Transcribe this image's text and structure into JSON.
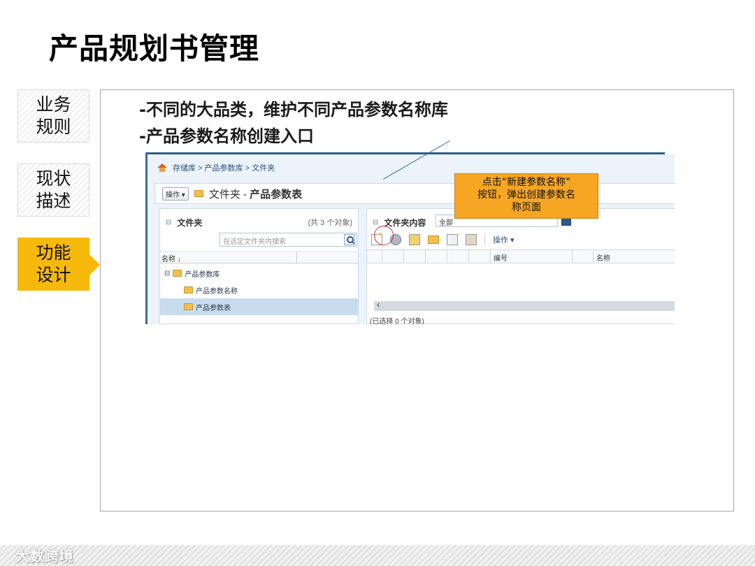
{
  "slide": {
    "title": "产品规划书管理",
    "tabs": [
      {
        "line1": "业务",
        "line2": "规则"
      },
      {
        "line1": "现状",
        "line2": "描述"
      },
      {
        "line1": "功能",
        "line2": "设计"
      }
    ],
    "bullets": [
      "-不同的大品类，维护不同产品参数名称库",
      "-产品参数名称创建入口"
    ],
    "callout": {
      "line1": "点击“新建参数名称”",
      "line2": "按钮，弹出创建参数名",
      "line3": "称页面"
    },
    "watermark": "大数跨境",
    "accent_color": "#f6b90c"
  },
  "screenshot": {
    "breadcrumb": "存储库 > 产品参数库 > 文件夹",
    "operate_button": "操作 ▾",
    "title_prefix": "文件夹 - ",
    "title_bold": "产品参数表",
    "left_pane": {
      "header": "文件夹",
      "count": "(共 3 个对象)",
      "search_placeholder": "在选定文件夹内搜索",
      "column": "名称 ↓",
      "tree": [
        "产品参数库",
        "产品参数名称",
        "产品参数表"
      ]
    },
    "right_pane": {
      "header": "文件夹内容",
      "filter": "全部",
      "toolbar_menu": "操作 ▾",
      "columns": [
        "编号",
        "名称"
      ],
      "status": "(已选择 0 个对象)"
    }
  }
}
